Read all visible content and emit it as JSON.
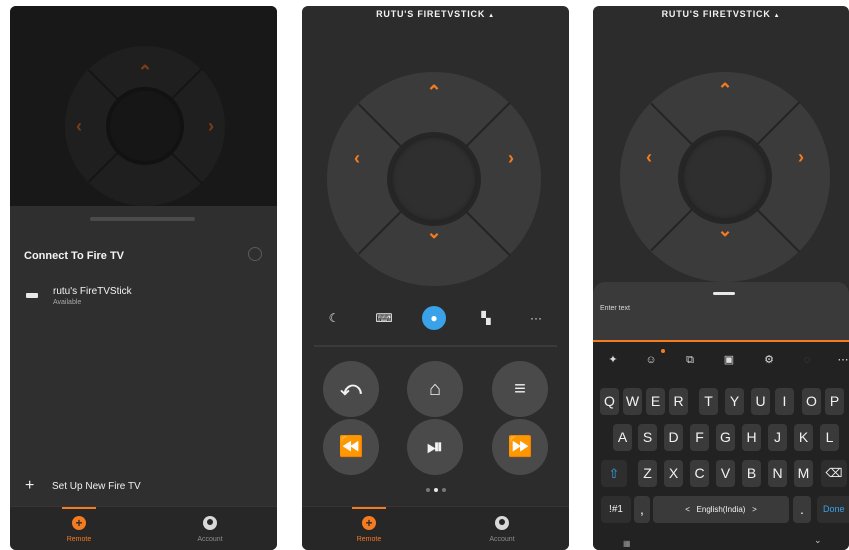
{
  "colors": {
    "accent": "#f47b20",
    "mic": "#3aa2e8",
    "background": "#2c2c2c"
  },
  "tabs": {
    "remote": "Remote",
    "account": "Account"
  },
  "panel1": {
    "connect_title": "Connect To Fire TV",
    "device": {
      "name": "rutu's FireTVStick",
      "status": "Available"
    },
    "setup_label": "Set Up New Fire TV"
  },
  "panel2": {
    "device_title": "RUTU'S FIRETVSTICK",
    "caret": "▲",
    "quick_icons": [
      "moon-icon",
      "keyboard-icon",
      "microphone-icon",
      "apps-icon",
      "more-icon"
    ],
    "more_label": "···",
    "controls": [
      "back-icon",
      "home-icon",
      "menu-icon",
      "rewind-icon",
      "play-pause-icon",
      "fast-forward-icon"
    ],
    "page_dots": {
      "count": 3,
      "active": 2
    }
  },
  "panel3": {
    "device_title": "RUTU'S FIRETVSTICK",
    "caret": "▲",
    "input_placeholder": "Enter text",
    "keyboard": {
      "row1": [
        "Q",
        "W",
        "E",
        "R",
        "T",
        "Y",
        "U",
        "I",
        "O",
        "P"
      ],
      "row2": [
        "A",
        "S",
        "D",
        "F",
        "G",
        "H",
        "J",
        "K",
        "L"
      ],
      "row3": [
        "Z",
        "X",
        "C",
        "V",
        "B",
        "N",
        "M"
      ],
      "symbols_key": "!#1",
      "comma_key": ",",
      "space_label": "English(India)",
      "space_left": "<",
      "space_right": ">",
      "period_key": ".",
      "done_label": "Done"
    }
  }
}
